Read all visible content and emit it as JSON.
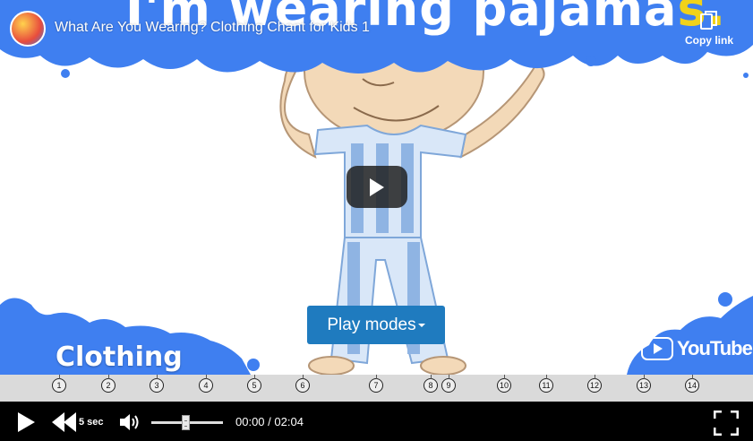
{
  "video": {
    "caption_top_main": "I'm wearing pajama",
    "caption_top_highlight": "s.",
    "title": "What Are You Wearing? Clothing Chant for Kids 1",
    "copy_link_label": "Copy link",
    "play_modes_label": "Play modes",
    "corner_caption": "Clothing",
    "watermark": "YouTube",
    "accent_color": "#1f7bbf",
    "cloud_color": "#3f7ff0"
  },
  "markers": [
    "1",
    "2",
    "3",
    "4",
    "5",
    "6",
    "7",
    "8",
    "9",
    "10",
    "11",
    "12",
    "13",
    "14"
  ],
  "controls": {
    "skip_label": "5 sec",
    "current_time": "00:00",
    "duration": "02:04",
    "time_separator": " / ",
    "volume_level": 0.45
  },
  "icons": {
    "play": "play-icon",
    "rewind": "rewind-icon",
    "volume": "volume-icon",
    "fullscreen": "fullscreen-icon",
    "copy": "copy-icon"
  }
}
